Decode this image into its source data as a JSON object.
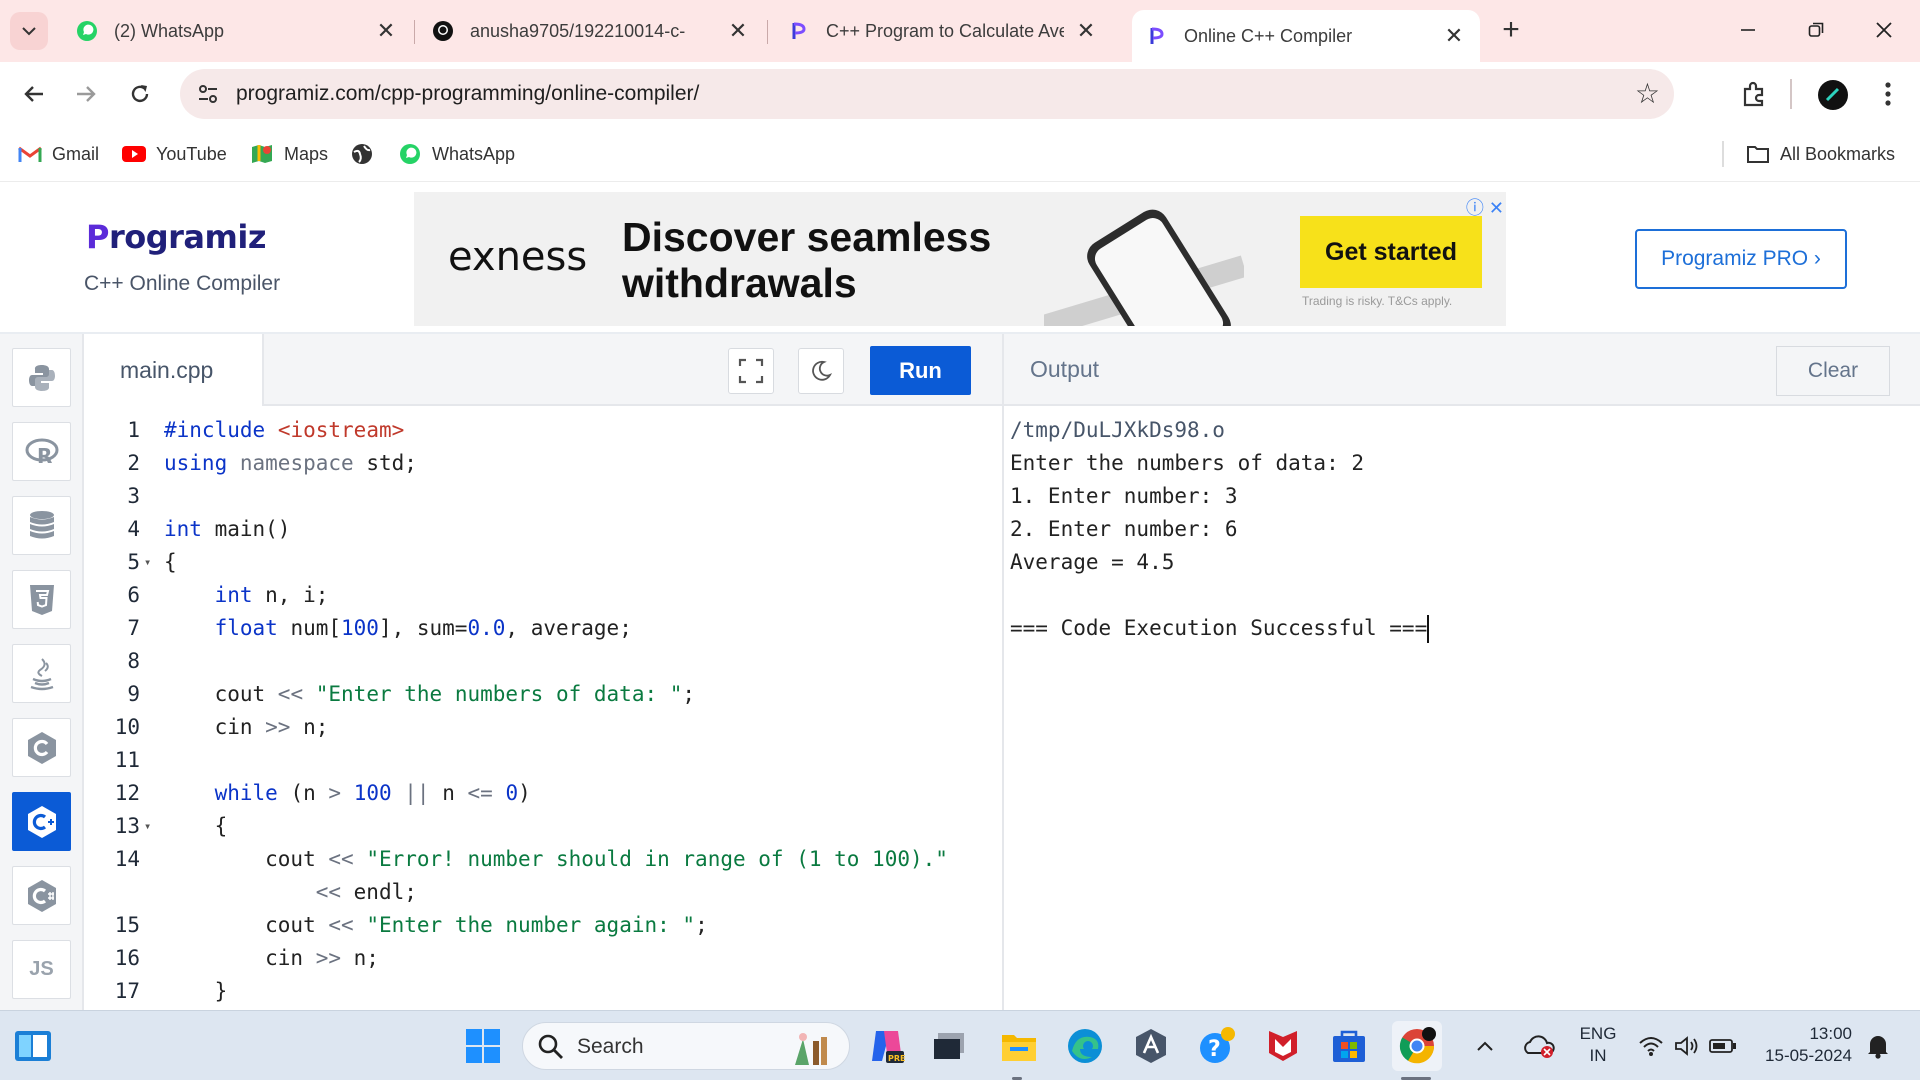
{
  "browser": {
    "tabs": [
      {
        "title": "(2) WhatsApp",
        "icon": "whatsapp-icon",
        "active": false
      },
      {
        "title": "anusha9705/192210014-c-",
        "icon": "github-icon",
        "active": false
      },
      {
        "title": "C++ Program to Calculate Aver",
        "icon": "programiz-icon",
        "active": false
      },
      {
        "title": "Online C++ Compiler",
        "icon": "programiz-icon",
        "active": true
      }
    ],
    "url": "programiz.com/cpp-programming/online-compiler/",
    "bookmarks": [
      {
        "label": "Gmail",
        "icon": "gmail-icon"
      },
      {
        "label": "YouTube",
        "icon": "youtube-icon"
      },
      {
        "label": "Maps",
        "icon": "maps-icon"
      },
      {
        "label": "",
        "icon": "globe-icon"
      },
      {
        "label": "WhatsApp",
        "icon": "whatsapp-icon"
      }
    ],
    "all_bookmarks_label": "All Bookmarks"
  },
  "site": {
    "logo_text": "rogramiz",
    "logo_p": "P",
    "subtitle": "C++ Online Compiler",
    "pro_button": "Programiz PRO ›",
    "ad": {
      "brand": "exness",
      "headline": "Discover seamless withdrawals",
      "cta": "Get started",
      "disclaimer": "Trading is risky. T&Cs apply."
    }
  },
  "languages": [
    "python-icon",
    "r-icon",
    "sql-icon",
    "html5-icon",
    "java-icon",
    "c-icon",
    "cpp-icon",
    "csharp-icon",
    "js-icon"
  ],
  "languages_js_label": "JS",
  "editor": {
    "filename": "main.cpp",
    "run_label": "Run",
    "lines": [
      {
        "n": "1",
        "html": "<span class=\"kw\">#include</span> <span class=\"inc\">&lt;iostream&gt;</span>"
      },
      {
        "n": "2",
        "html": "<span class=\"kw\">using</span> <span class=\"op\">namespace</span> std;"
      },
      {
        "n": "3",
        "html": ""
      },
      {
        "n": "4",
        "html": "<span class=\"kw\">int</span> main()"
      },
      {
        "n": "5",
        "fold": true,
        "html": "{"
      },
      {
        "n": "6",
        "html": "    <span class=\"kw\">int</span> n, i;"
      },
      {
        "n": "7",
        "html": "    <span class=\"kw\">float</span> num[<span class=\"num\">100</span>], sum=<span class=\"num\">0.0</span>, average;"
      },
      {
        "n": "8",
        "html": ""
      },
      {
        "n": "9",
        "html": "    cout <span class=\"op\">&lt;&lt;</span> <span class=\"str\">\"Enter the numbers of data: \"</span>;"
      },
      {
        "n": "10",
        "html": "    cin <span class=\"op\">&gt;&gt;</span> n;"
      },
      {
        "n": "11",
        "html": ""
      },
      {
        "n": "12",
        "html": "    <span class=\"kw\">while</span> (n <span class=\"op\">&gt;</span> <span class=\"num\">100</span> <span class=\"op\">||</span> n <span class=\"op\">&lt;=</span> <span class=\"num\">0</span>)"
      },
      {
        "n": "13",
        "fold": true,
        "html": "    {"
      },
      {
        "n": "14",
        "html": "        cout <span class=\"op\">&lt;&lt;</span> <span class=\"str\">\"Error! number should in range of (1 to 100).\"</span>"
      },
      {
        "n": "",
        "html": "            <span class=\"op\">&lt;&lt;</span> endl;"
      },
      {
        "n": "15",
        "html": "        cout <span class=\"op\">&lt;&lt;</span> <span class=\"str\">\"Enter the number again: \"</span>;"
      },
      {
        "n": "16",
        "html": "        cin <span class=\"op\">&gt;&gt;</span> n;"
      },
      {
        "n": "17",
        "html": "    }"
      }
    ]
  },
  "output": {
    "title": "Output",
    "clear_label": "Clear",
    "lines": [
      "/tmp/DuLJXkDs98.o",
      "Enter the numbers of data: 2",
      "1. Enter number: 3",
      "2. Enter number: 6",
      "Average = 4.5",
      "",
      "=== Code Execution Successful ==="
    ]
  },
  "taskbar": {
    "search_label": "Search",
    "lang_line1": "ENG",
    "lang_line2": "IN",
    "time": "13:00",
    "date": "15-05-2024"
  },
  "colors": {
    "accent": "#0b5bd6",
    "chrome_bg": "#fde7e7",
    "ad_cta": "#f7e11a"
  }
}
